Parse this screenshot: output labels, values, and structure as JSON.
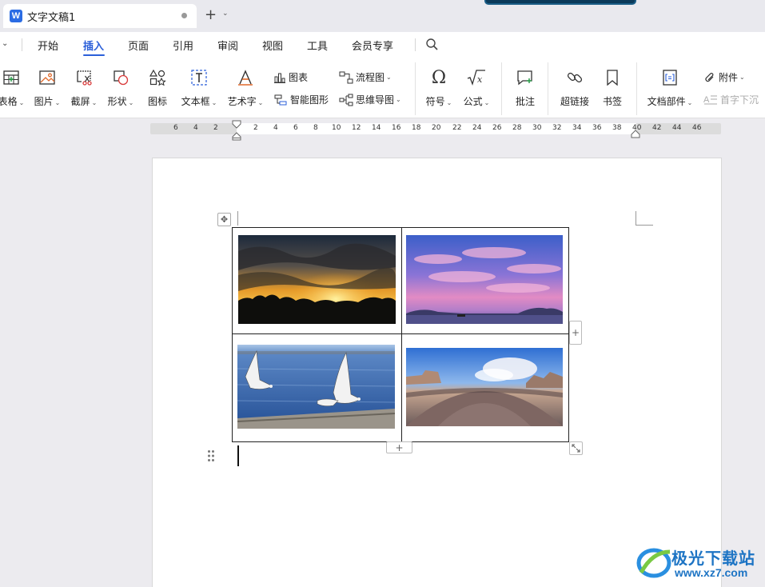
{
  "tab": {
    "logo": "W",
    "title": "文字文稿1"
  },
  "menu": {
    "items": [
      "开始",
      "插入",
      "页面",
      "引用",
      "审阅",
      "视图",
      "工具",
      "会员专享"
    ],
    "active": "插入"
  },
  "ribbon": {
    "table": "表格",
    "picture": "图片",
    "screenshot": "截屏",
    "shape": "形状",
    "icon": "图标",
    "textbox": "文本框",
    "wordart": "艺术字",
    "chart": "图表",
    "smartart": "智能图形",
    "flowchart": "流程图",
    "mindmap": "思维导图",
    "symbol": "符号",
    "formula": "公式",
    "comment": "批注",
    "hyperlink": "超链接",
    "bookmark": "书签",
    "docparts": "文档部件",
    "attachment": "附件",
    "dropcap": "首字下沉"
  },
  "ruler": {
    "left_numbers": [
      "6",
      "4",
      "2"
    ],
    "right_numbers": [
      "2",
      "4",
      "6",
      "8",
      "10",
      "12",
      "14",
      "16",
      "18",
      "20",
      "22",
      "24",
      "26",
      "28",
      "30",
      "32",
      "34",
      "36",
      "38",
      "40",
      "42",
      "44",
      "46"
    ]
  },
  "table": {
    "cells": [
      "sunset-photo",
      "pink-sky-photo",
      "seagulls-photo",
      "panorama-photo"
    ],
    "add_symbol": "+"
  },
  "watermark": {
    "brand": "极光下载站",
    "url": "www.xz7.com"
  },
  "colors": {
    "accent": "#2b5fd9",
    "logo": "#2b6ce4",
    "watermark": "#1d74c4"
  }
}
